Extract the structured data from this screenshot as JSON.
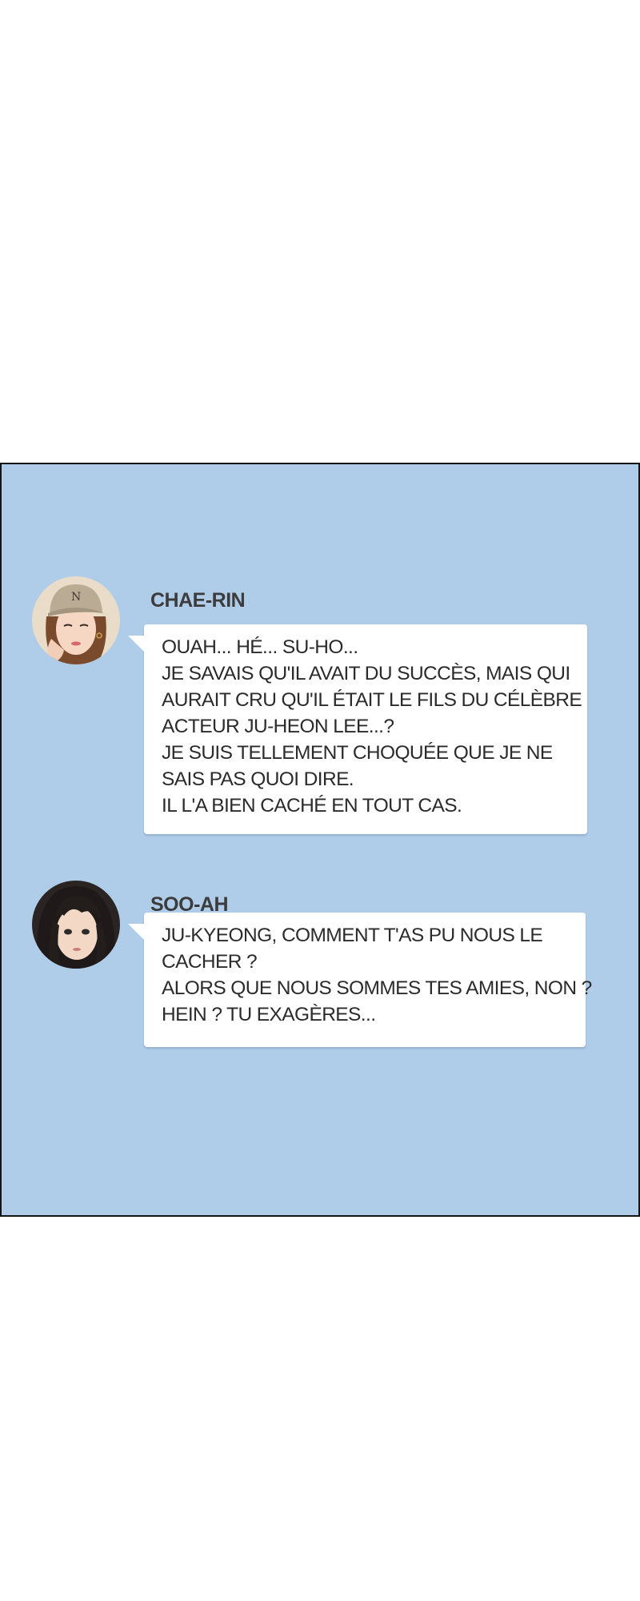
{
  "chat": {
    "messages": [
      {
        "sender": "CHAE-RIN",
        "avatar_icon": "woman-in-cap-avatar-icon",
        "lines": [
          "OUAH... HÉ... SU-HO...",
          "JE SAVAIS QU'IL AVAIT DU SUCCÈS, MAIS QUI",
          "AURAIT CRU QU'IL ÉTAIT LE FILS DU CÉLÈBRE",
          "ACTEUR JU-HEON LEE...?",
          "JE SUIS TELLEMENT CHOQUÉE QUE JE NE",
          "SAIS PAS QUOI DIRE.",
          "IL L'A BIEN CACHÉ EN TOUT CAS."
        ]
      },
      {
        "sender": "SOO-AH",
        "avatar_icon": "woman-dark-hair-avatar-icon",
        "lines": [
          "JU-KYEONG, COMMENT T'AS PU NOUS LE",
          "CACHER ?",
          "ALORS QUE NOUS SOMMES TES AMIES, NON ?",
          "HEIN ? TU EXAGÈRES..."
        ]
      }
    ]
  },
  "colors": {
    "panel_background": "#afcde9",
    "panel_border": "#151515",
    "bubble_background": "#ffffff",
    "name_text": "#3c3c3c",
    "message_text": "#2b2b2b"
  }
}
